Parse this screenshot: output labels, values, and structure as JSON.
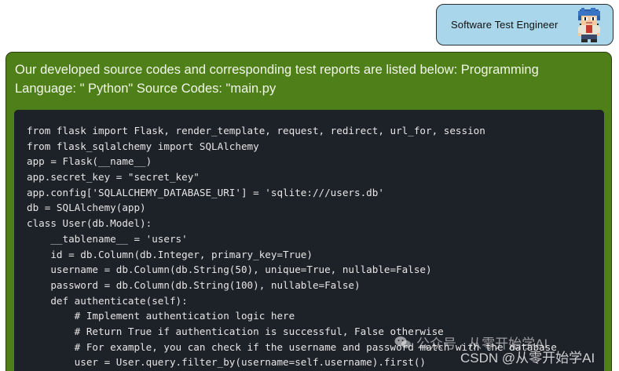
{
  "role_badge": {
    "label": "Software Test Engineer",
    "avatar_icon": "pixel-art-engineer-avatar"
  },
  "message": {
    "text": "Our developed source codes and corresponding test reports are listed below: Programming Language: \" Python\" Source Codes: \"main.py",
    "bubble_color": "#4f7f18",
    "code_lines": [
      "from flask import Flask, render_template, request, redirect, url_for, session",
      "from flask_sqlalchemy import SQLAlchemy",
      "app = Flask(__name__)",
      "app.secret_key = \"secret_key\"",
      "app.config['SQLALCHEMY_DATABASE_URI'] = 'sqlite:///users.db'",
      "db = SQLAlchemy(app)",
      "class User(db.Model):",
      "    __tablename__ = 'users'",
      "    id = db.Column(db.Integer, primary_key=True)",
      "    username = db.Column(db.String(50), unique=True, nullable=False)",
      "    password = db.Column(db.String(100), nullable=False)",
      "    def authenticate(self):",
      "        # Implement authentication logic here",
      "        # Return True if authentication is successful, False otherwise",
      "        # For example, you can check if the username and password match with the database",
      "        user = User.query.filter_by(username=self.username).first()"
    ]
  },
  "watermark": {
    "line1": "公众号 · 从零开始学AI",
    "line2": "CSDN @从零开始学AI"
  }
}
